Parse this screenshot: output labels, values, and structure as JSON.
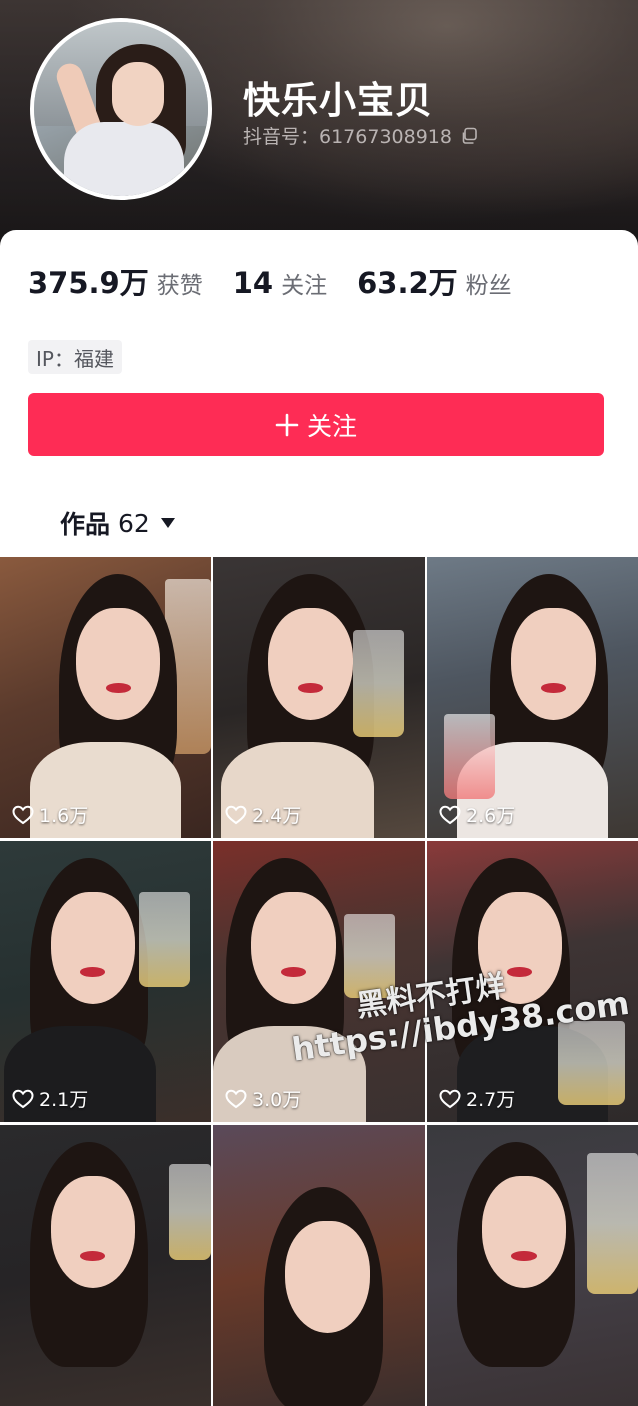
{
  "profile": {
    "name": "快乐小宝贝",
    "douyin_id": "抖音号：61767308918",
    "ip": "IP：福建",
    "follow_button": "关注"
  },
  "stats": [
    {
      "value": "375.9万",
      "label": "获赞"
    },
    {
      "value": "14",
      "label": "关注"
    },
    {
      "value": "63.2万",
      "label": "粉丝"
    }
  ],
  "works_tab": {
    "label": "作品",
    "count": "62"
  },
  "videos": [
    {
      "likes": "1.6万"
    },
    {
      "likes": "2.4万"
    },
    {
      "likes": "2.6万"
    },
    {
      "likes": "2.1万"
    },
    {
      "likes": "3.0万"
    },
    {
      "likes": "2.7万"
    },
    {
      "likes": ""
    },
    {
      "likes": ""
    },
    {
      "likes": ""
    }
  ],
  "watermark": {
    "line1": "黑料不打烊",
    "line2": "https://ibdy38.com"
  },
  "colors": {
    "accent": "#fe2c55",
    "text": "#161823",
    "muted": "#6b6d74"
  },
  "icons": [
    "copy-icon",
    "plus-icon",
    "caret-down-icon",
    "heart-icon"
  ]
}
